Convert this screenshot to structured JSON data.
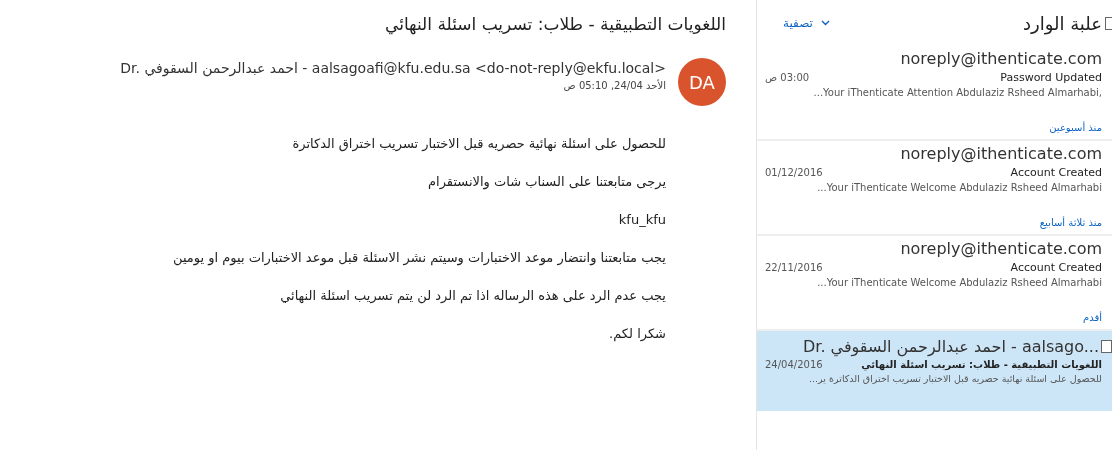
{
  "reading_pane": {
    "subject": "اللغويات التطبيقية - طلاب: تسريب اسئلة النهائي",
    "avatar_initials": "DA",
    "sender": "Dr. احمد عبدالرحمن السقوفي - aalsagoafi@kfu.edu.sa <do-not-reply@ekfu.local>",
    "date": "الأحد 24/04, 05:10 ص",
    "body": [
      "للحصول على اسئلة نهائية حصريه قبل الاختبار  تسريب   اختراق الدكاترة",
      "يرجى متابعتنا على السناب شات والانستقرام",
      "kfu_kfu",
      "يجب متابعتنا وانتضار موعد الاختبارات وسيتم نشر الاسئلة قبل موعد الاختبارات بيوم او يومين",
      "يجب عدم الرد على هذه الرساله  اذا تم الرد لن يتم تسريب اسئلة النهائي",
      "شكرا لكم."
    ]
  },
  "message_list": {
    "title": "علبة الوارد",
    "filter_label": "تصفية",
    "select_all_checked": false,
    "items": [
      {
        "kind": "message",
        "selected": false,
        "sender": "noreply@ithenticate.com",
        "subject": "Password Updated",
        "time": "03:00 ص",
        "preview": "...Your iThenticate  Attention Abdulaziz Rsheed Almarhabi,"
      },
      {
        "kind": "group",
        "label": "منذ أسبوعين"
      },
      {
        "kind": "message",
        "selected": false,
        "sender": "noreply@ithenticate.com",
        "subject": "Account Created",
        "time": "01/12/2016",
        "preview": "...Your iThenticate  Welcome Abdulaziz Rsheed Almarhabi"
      },
      {
        "kind": "group",
        "label": "منذ ثلاثة أسابيع"
      },
      {
        "kind": "message",
        "selected": false,
        "sender": "noreply@ithenticate.com",
        "subject": "Account Created",
        "time": "22/11/2016",
        "preview": "...Your iThenticate  Welcome Abdulaziz Rsheed Almarhabi"
      },
      {
        "kind": "group",
        "label": "أقدم"
      },
      {
        "kind": "message",
        "selected": true,
        "checked": false,
        "sender": "Dr. احمد عبدالرحمن السقوفي - aalsago...",
        "subject": "اللغويات التطبيقية - طلاب: تسريب اسئلة النهائي",
        "time": "24/04/2016",
        "preview": "للحصول على اسئلة نهائية حصريه قبل الاختبار تسريب اختراق الدكاترة ير..."
      }
    ]
  }
}
